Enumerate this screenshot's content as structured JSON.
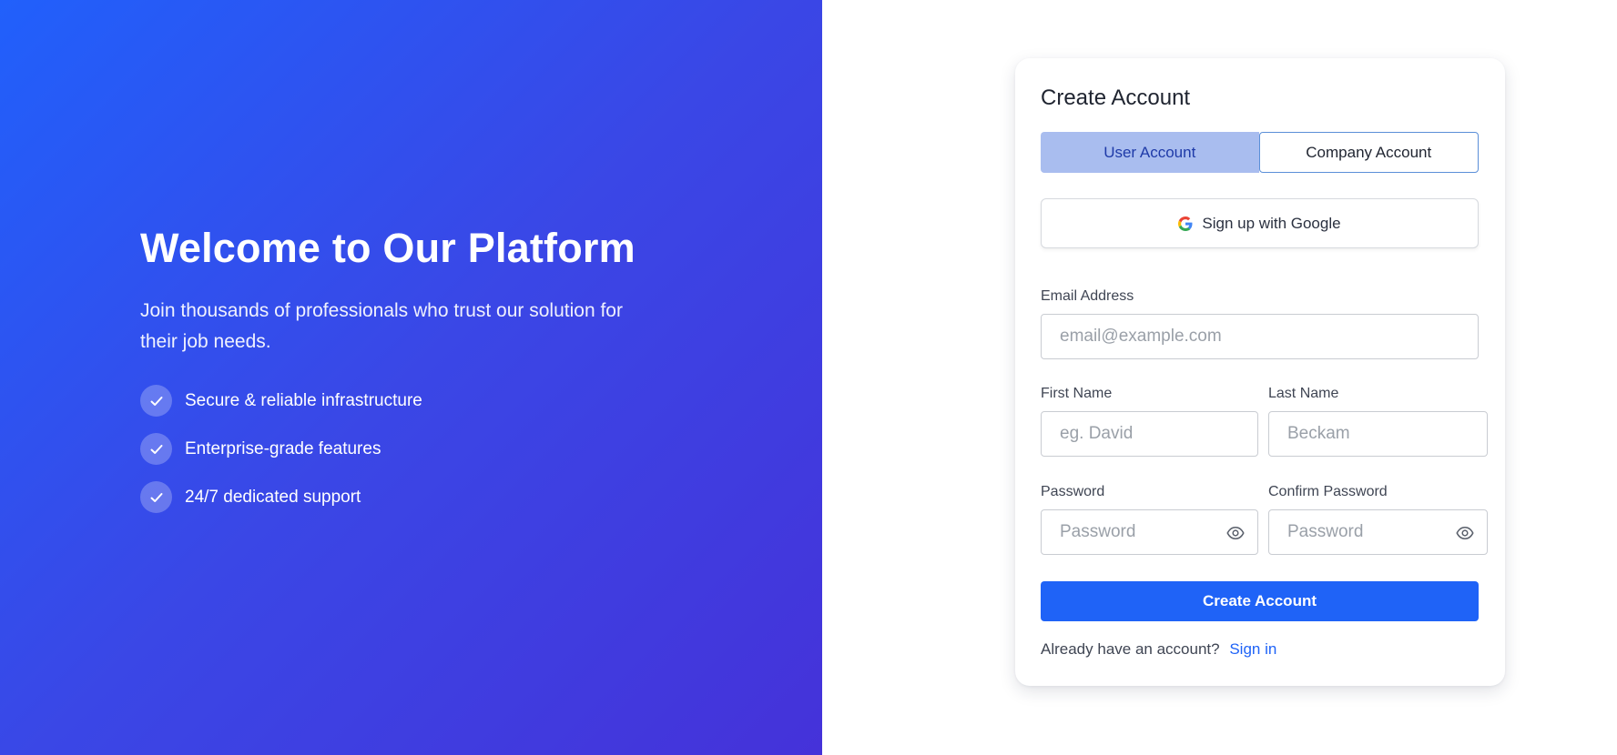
{
  "hero": {
    "title": "Welcome to Our Platform",
    "subtitle": "Join thousands of professionals who trust our solution for their job needs.",
    "features": [
      {
        "label": "Secure & reliable infrastructure",
        "icon": "check-icon"
      },
      {
        "label": "Enterprise-grade features",
        "icon": "check-icon"
      },
      {
        "label": "24/7 dedicated support",
        "icon": "check-icon"
      }
    ]
  },
  "form": {
    "title": "Create Account",
    "tabs": [
      {
        "label": "User Account",
        "active": true
      },
      {
        "label": "Company Account",
        "active": false
      }
    ],
    "google_label": "Sign up with Google",
    "email": {
      "label": "Email Address",
      "placeholder": "email@example.com",
      "value": ""
    },
    "first_name": {
      "label": "First Name",
      "placeholder": "eg. David",
      "value": ""
    },
    "last_name": {
      "label": "Last Name",
      "placeholder": "Beckam",
      "value": ""
    },
    "password": {
      "label": "Password",
      "placeholder": "Password",
      "value": "",
      "icon": "eye-icon"
    },
    "confirm_password": {
      "label": "Confirm Password",
      "placeholder": "Password",
      "value": "",
      "icon": "eye-icon"
    },
    "submit_label": "Create Account",
    "signin_prompt": "Already have an account?",
    "signin_link": "Sign in"
  },
  "colors": {
    "accent": "#1f63f7",
    "gradient_start": "#2160fb",
    "gradient_end": "#4532d9",
    "active_tab_bg": "#a9bdef"
  }
}
